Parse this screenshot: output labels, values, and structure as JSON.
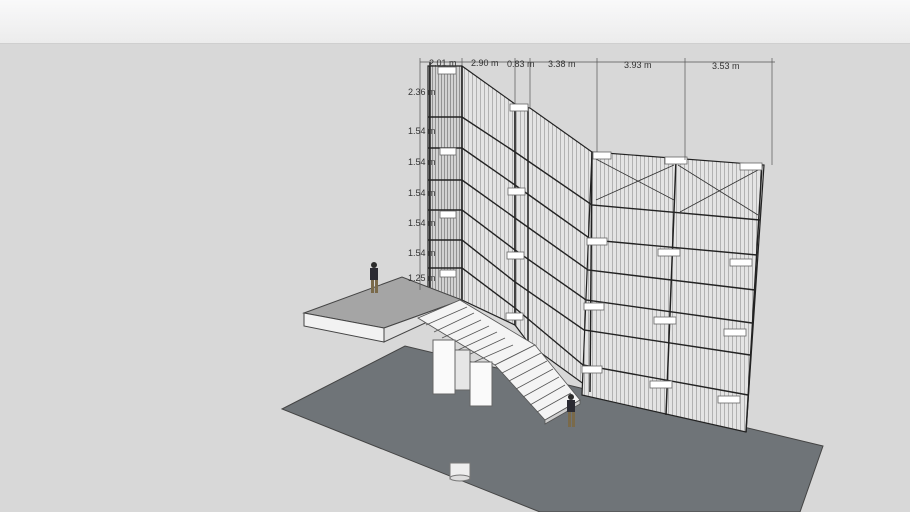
{
  "viewport": {
    "background": "#d8d8d8",
    "sky": "#f2f2f3",
    "ground": "#6f7478"
  },
  "dimensions": {
    "top": [
      "2.01 m",
      "2.90 m",
      "0.83 m",
      "3.38 m",
      "3.93 m",
      "3.53 m"
    ],
    "side": [
      "2.36 m",
      "1.54 m",
      "1.54 m",
      "1.54 m",
      "1.54 m",
      "1.54 m",
      "1.25 m"
    ]
  }
}
